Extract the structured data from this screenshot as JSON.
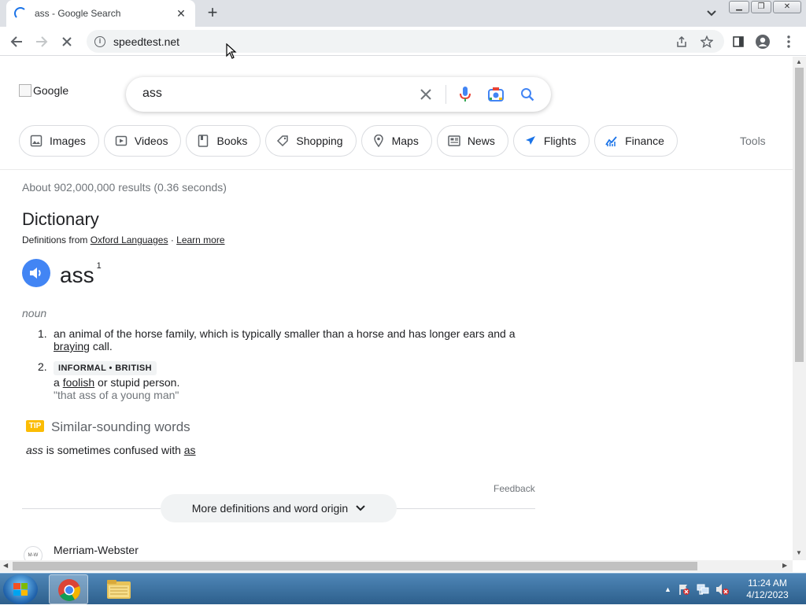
{
  "browser": {
    "tab_title": "ass - Google Search",
    "url": "speedtest.net"
  },
  "google": {
    "logo_alt": "Google",
    "query": "ass",
    "chips": [
      {
        "label": "Images",
        "icon": "image-icon"
      },
      {
        "label": "Videos",
        "icon": "video-icon"
      },
      {
        "label": "Books",
        "icon": "book-icon"
      },
      {
        "label": "Shopping",
        "icon": "tag-icon"
      },
      {
        "label": "Maps",
        "icon": "map-pin-icon"
      },
      {
        "label": "News",
        "icon": "news-icon"
      },
      {
        "label": "Flights",
        "icon": "plane-icon"
      },
      {
        "label": "Finance",
        "icon": "finance-icon"
      }
    ],
    "tools_label": "Tools",
    "result_stats": "About 902,000,000 results (0.36 seconds)"
  },
  "dictionary": {
    "title": "Dictionary",
    "source_prefix": "Definitions from",
    "source_link": "Oxford Languages",
    "source_sep": "·",
    "learn_more": "Learn more",
    "headword": "ass",
    "superscript": "1",
    "part_of_speech": "noun",
    "definitions": [
      {
        "num": "1.",
        "text_before": "an animal of the horse family, which is typically smaller than a horse and has longer ears and a",
        "link": "braying",
        "text_after": "call."
      },
      {
        "num": "2.",
        "tag": "INFORMAL • BRITISH",
        "text_before": "a",
        "link": "foolish",
        "text_after": "or stupid person.",
        "example": "\"that ass of a young man\""
      }
    ],
    "tip": {
      "badge": "TIP",
      "title": "Similar-sounding words",
      "word": "ass",
      "middle": "is sometimes confused with",
      "link": "as"
    },
    "feedback": "Feedback",
    "more_button": "More definitions and word origin"
  },
  "next_result": {
    "logo_text": "M-W",
    "name": "Merriam-Webster"
  },
  "taskbar": {
    "time": "11:24 AM",
    "date": "4/12/2023"
  },
  "colors": {
    "accent_blue": "#4285f4",
    "link_blue": "#1a73e8",
    "tip_yellow": "#fbbc04"
  }
}
